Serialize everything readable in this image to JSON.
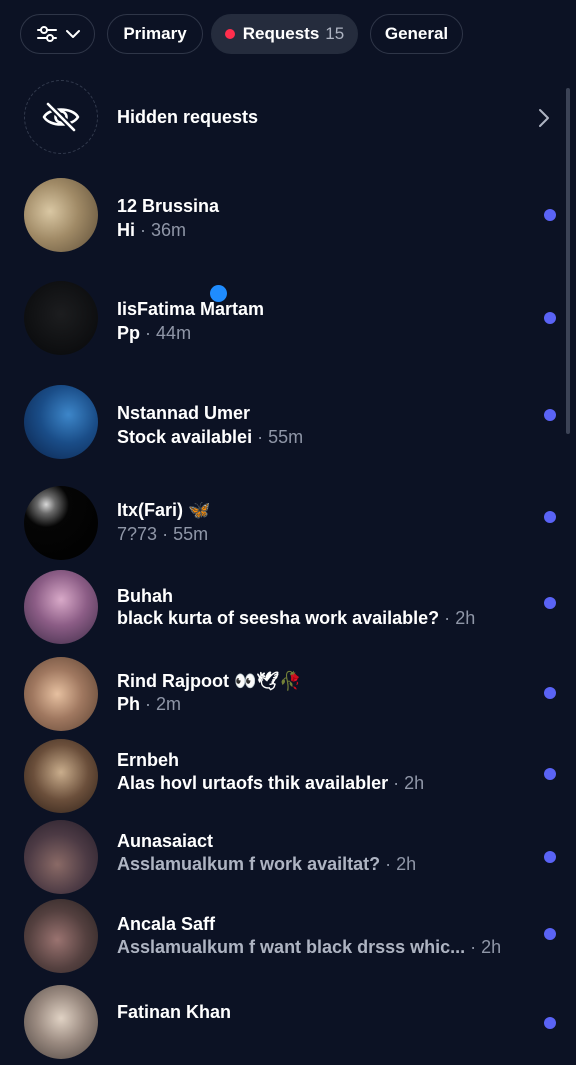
{
  "tabs": {
    "filter": {
      "icon": "sliders-icon",
      "chevron": "chevron-down-icon"
    },
    "primary_label": "Primary",
    "requests_label": "Requests",
    "requests_count": "15",
    "general_label": "General"
  },
  "hidden_requests": {
    "icon": "eye-off-icon",
    "label": "Hidden requests",
    "chevron": "chevron-right-icon"
  },
  "requests": [
    {
      "name": "12 Brussina",
      "message": "Hi",
      "separator": "·",
      "time": "36m",
      "unread": true
    },
    {
      "name": "IisFatima Martam",
      "message": "Pp",
      "separator": "·",
      "time": "44m",
      "unread": true
    },
    {
      "name": "Nstannad Umer",
      "message": "Stock availablei",
      "separator": "·",
      "time": "55m",
      "unread": true
    },
    {
      "name": "Itx(Fari) 🦋",
      "message": "7?73",
      "separator": "·",
      "time": "55m",
      "unread": true
    },
    {
      "name": "Buhah",
      "message": "black kurta of seesha work available?",
      "separator": "·",
      "time": "2h",
      "unread": true
    },
    {
      "name": "Rind Rajpoot 👀🕊🥀",
      "message": "Ph",
      "separator": "·",
      "time": "2m",
      "unread": true
    },
    {
      "name": "Ernbeh",
      "message": "Alas hovl urtaofs thik availabler",
      "separator": "·",
      "time": "2h",
      "unread": true
    },
    {
      "name": "Aunasaiact",
      "message": "Asslamualkum f work availtat?",
      "separator": "·",
      "time": "2h",
      "unread": true
    },
    {
      "name": "Ancala Saff",
      "message": "Asslamualkum f want black drsss whic...",
      "separator": "·",
      "time": "2h",
      "unread": true
    },
    {
      "name": "Fatinan Khan",
      "message": "",
      "separator": "",
      "time": "",
      "unread": true
    }
  ],
  "colors": {
    "background": "#0c1224",
    "unread_dot": "#5a63f5",
    "requests_dot": "#ff2e4d",
    "accent_blue": "#1f8cff"
  }
}
